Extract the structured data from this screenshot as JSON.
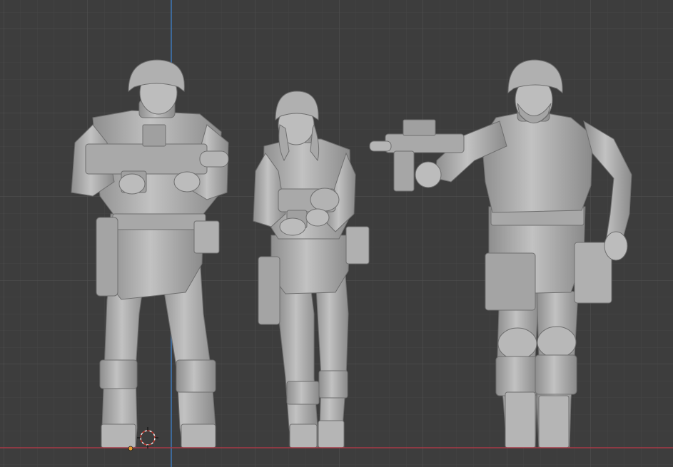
{
  "viewport": {
    "background_color": "#3d3d3d",
    "minor_grid_color": "#454545",
    "major_grid_color": "#525252",
    "x_axis_color": "#a83a46",
    "y_axis_color": "#3f78b8",
    "mesh_color": "#b7b7b7",
    "mesh_shadow_color": "#7e7e7e",
    "mesh_highlight_color": "#d2d2d2",
    "origin_dot_color": "#e89a2c"
  },
  "scene": {
    "objects": [
      {
        "name": "soldier-figure-left",
        "pose": "holding-heavy-rifle"
      },
      {
        "name": "soldier-figure-middle",
        "pose": "holding-blaster-pistol"
      },
      {
        "name": "soldier-figure-right",
        "pose": "aiming-pistol"
      }
    ]
  },
  "icons": {
    "cursor": "3d-cursor-icon",
    "origin": "origin-point-icon"
  }
}
